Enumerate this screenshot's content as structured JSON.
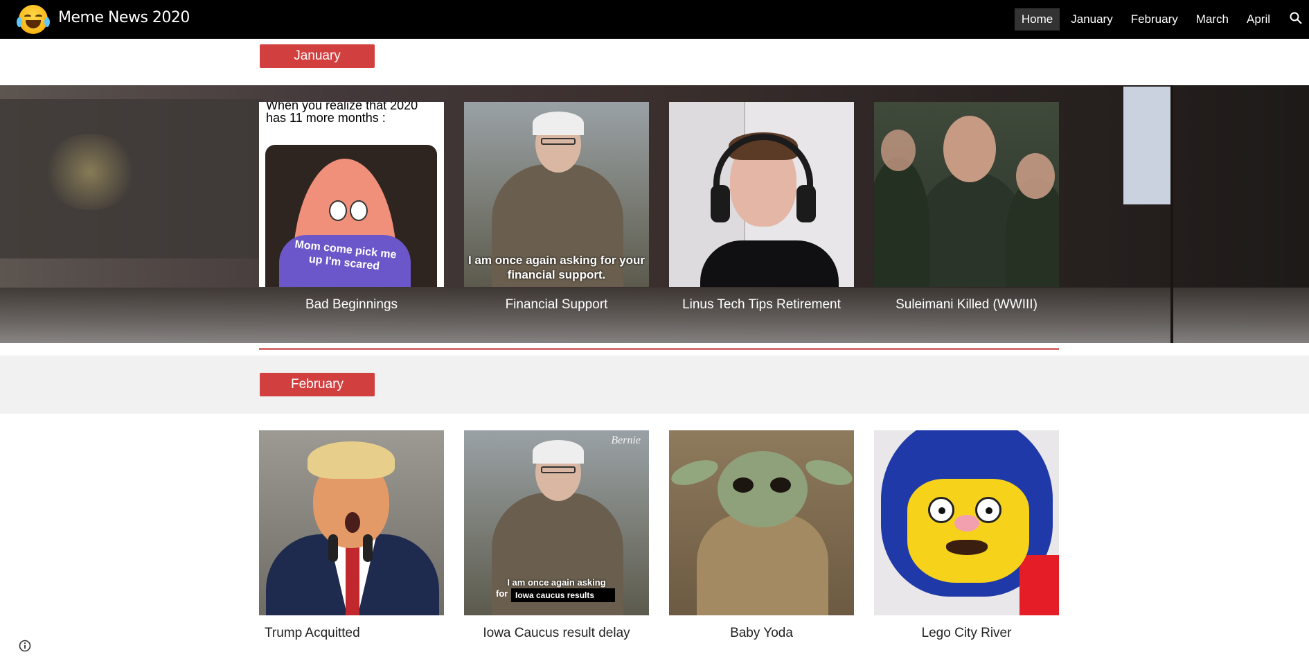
{
  "header": {
    "site_title": "Meme News 2020",
    "logo_icon": "laughing-crying-emoji-icon",
    "nav": [
      "Home",
      "January",
      "February",
      "March",
      "April"
    ],
    "active_nav": "Home",
    "search_icon": "search-icon"
  },
  "sections": {
    "january": {
      "label": "January",
      "cards": [
        {
          "caption": "Bad Beginnings",
          "meme_text": "When you realize that 2020 has 11 more months :",
          "shirt_text": "Mom come pick me up I'm scared"
        },
        {
          "caption": "Financial Support",
          "meme_text": "I am once again asking for your financial support."
        },
        {
          "caption": "Linus Tech Tips Retirement"
        },
        {
          "caption": "Suleimani Killed (WWIII)"
        }
      ]
    },
    "february": {
      "label": "February",
      "cards": [
        {
          "caption": "Trump Acquitted"
        },
        {
          "caption": "Iowa Caucus result delay",
          "meme_text": "I am once again asking",
          "meme_text_2": "for",
          "overlay_text": "Iowa caucus results",
          "brand": "Bernie"
        },
        {
          "caption": "Baby Yoda"
        },
        {
          "caption": "Lego City River"
        }
      ]
    }
  },
  "footer": {
    "info_icon": "info-icon"
  },
  "colors": {
    "topbar": "#000000",
    "accent": "#d23f3f",
    "divider": "#d76f6f",
    "band_light": "#f1f1f1"
  }
}
